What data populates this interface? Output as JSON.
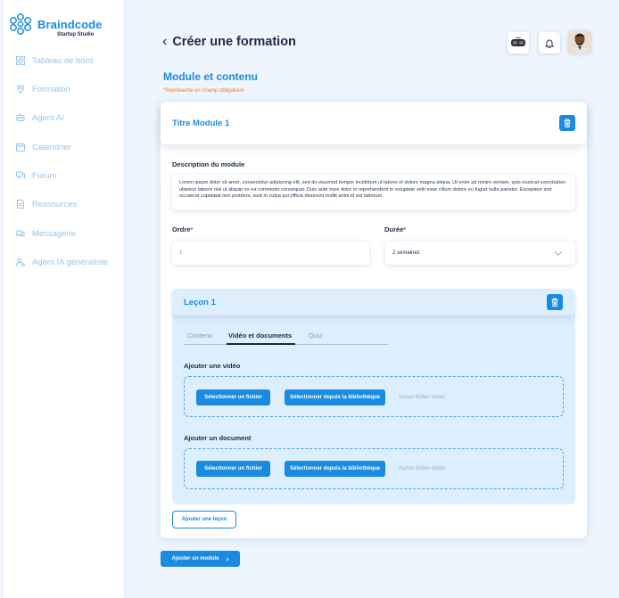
{
  "brand": {
    "name": "Braindcode",
    "subtitle": "Startup Studio",
    "color": "#1a8be0"
  },
  "sidebar": {
    "items": [
      {
        "label": "Tableau de bord",
        "icon": "dashboard-icon"
      },
      {
        "label": "Formation",
        "icon": "location-pin-icon"
      },
      {
        "label": "Agent AI",
        "icon": "robot-icon"
      },
      {
        "label": "Calendrier",
        "icon": "calendar-icon"
      },
      {
        "label": "Forum",
        "icon": "forum-icon"
      },
      {
        "label": "Ressources",
        "icon": "document-icon"
      },
      {
        "label": "Messagerie",
        "icon": "chat-icon"
      },
      {
        "label": "Agent IA généraliste",
        "icon": "user-gear-icon"
      }
    ]
  },
  "header": {
    "title": "Créer une formation",
    "back_icon": "chevron-left-icon",
    "vr_icon": "vr-headset-icon",
    "notification_icon": "bell-icon",
    "avatar_icon": "user-avatar"
  },
  "form": {
    "section_title": "Module et contenu",
    "required_note": "*Représente un champ obligatoire",
    "module": {
      "title": "Titre Module 1",
      "delete_icon": "trash-icon",
      "description_label": "Description du module",
      "description_value": "Lorem ipsum dolor sit amet, consectetur adipiscing elit, sed do eiusmod tempor incididunt ut labore et dolore magna aliqua. Ut enim ad minim veniam, quis nostrud exercitation ullamco laboris nisi ut aliquip ex ea commodo consequat. Duis aute irure dolor in reprehenderit in voluptate velit esse cillum dolore eu fugiat nulla pariatur. Excepteur sint occaecat cupidatat non proident, sunt in culpa qui officia deserunt mollit anim id est laborum.",
      "order_label": "Ordre",
      "order_value": "1",
      "duration_label": "Durée",
      "duration_value": "2 semaines",
      "required_marker": "*"
    },
    "lesson": {
      "title": "Leçon 1",
      "tabs": [
        {
          "label": "Contenu",
          "active": false
        },
        {
          "label": "Vidéo et documents",
          "active": true
        },
        {
          "label": "Quiz",
          "active": false
        }
      ],
      "video": {
        "label": "Ajouter une vidéo",
        "select_file": "Sélectionner un fichier",
        "select_library": "Sélectionner depuis la bibliothèque",
        "status": "Aucun fichier choisi"
      },
      "document": {
        "label": "Ajouter un document",
        "select_file": "Sélectionner un fichier",
        "select_library": "Sélectionner depuis la bibliothèque",
        "status": "Aucun fichier choisi"
      }
    },
    "add_lesson": "Ajouter une leçon",
    "add_module": "Ajouter un module"
  }
}
